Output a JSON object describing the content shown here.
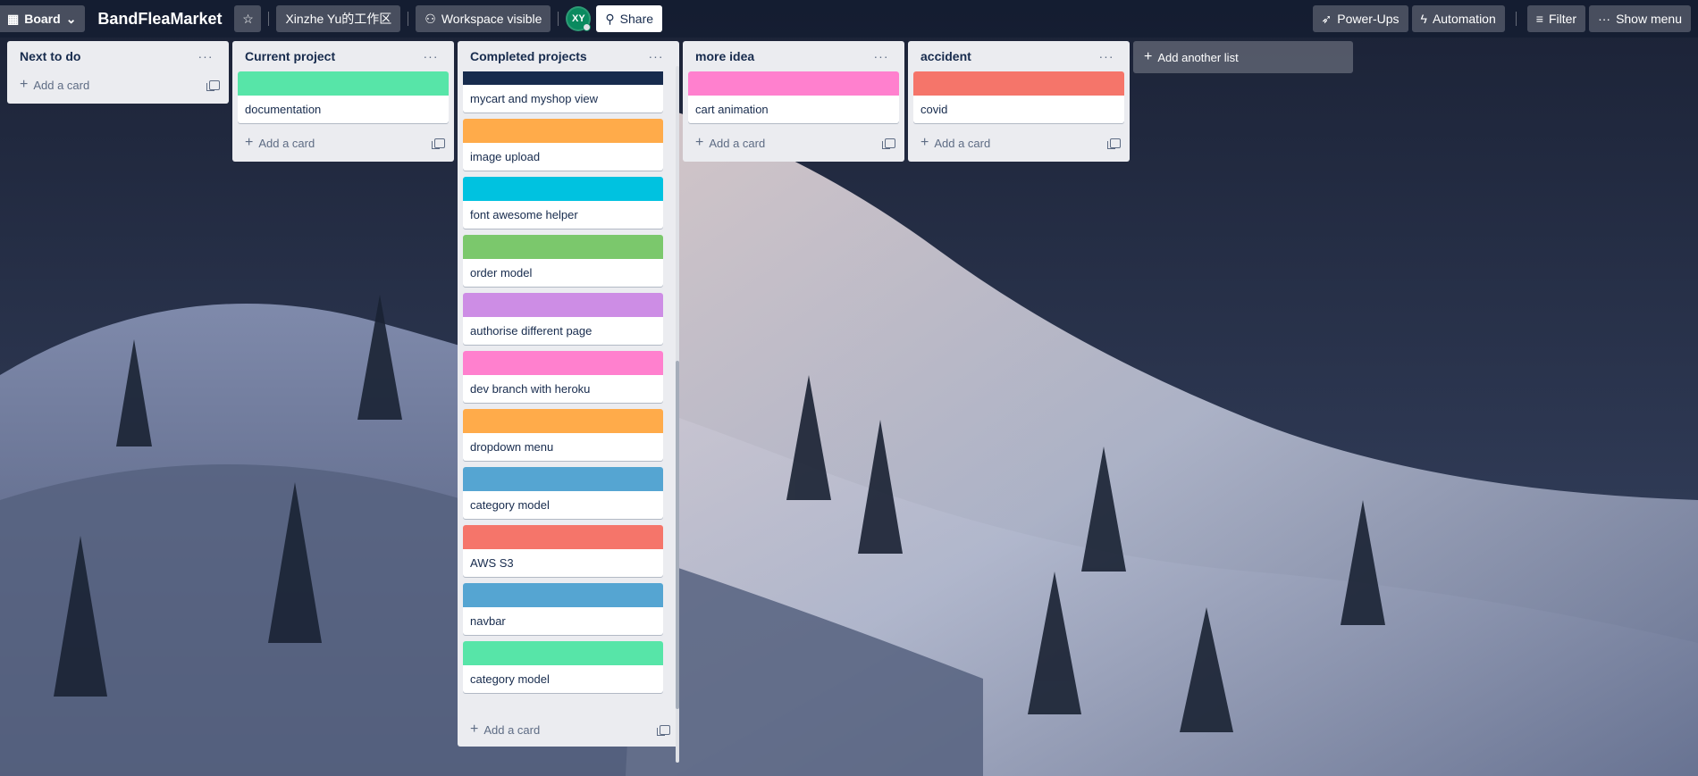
{
  "header": {
    "board_switcher_label": "Board",
    "board_title": "BandFleaMarket",
    "workspace_label": "Xinzhe Yu的工作区",
    "visibility_label": "Workspace visible",
    "avatar_initials": "XY",
    "share_label": "Share",
    "powerups_label": "Power-Ups",
    "automation_label": "Automation",
    "filter_label": "Filter",
    "menu_label": "Show menu"
  },
  "lists": [
    {
      "title": "Next to do",
      "cards": [],
      "add_label": "Add a card"
    },
    {
      "title": "Current project",
      "cards": [
        {
          "title": "documentation",
          "cover": "#57e5a8"
        }
      ],
      "add_label": "Add a card"
    },
    {
      "title": "Completed projects",
      "cards": [
        {
          "title": "mycart and myshop view",
          "cover": "#172b4d"
        },
        {
          "title": "image upload",
          "cover": "#ffab4a"
        },
        {
          "title": "font awesome helper",
          "cover": "#00c2e0"
        },
        {
          "title": "order model",
          "cover": "#7bc86c"
        },
        {
          "title": "authorise different page",
          "cover": "#cd8de5"
        },
        {
          "title": "dev branch with heroku",
          "cover": "#ff80ce"
        },
        {
          "title": "dropdown menu",
          "cover": "#ffab4a"
        },
        {
          "title": "category model",
          "cover": "#55a5d2"
        },
        {
          "title": "AWS S3",
          "cover": "#f5756a"
        },
        {
          "title": "navbar",
          "cover": "#55a5d2"
        },
        {
          "title": "category model",
          "cover": "#57e5a8"
        }
      ],
      "add_label": "Add a card"
    },
    {
      "title": "more idea",
      "cards": [
        {
          "title": "cart animation",
          "cover": "#ff80ce"
        }
      ],
      "add_label": "Add a card"
    },
    {
      "title": "accident",
      "cards": [
        {
          "title": "covid",
          "cover": "#f5756a"
        }
      ],
      "add_label": "Add a card"
    }
  ],
  "add_list_label": "Add another list"
}
